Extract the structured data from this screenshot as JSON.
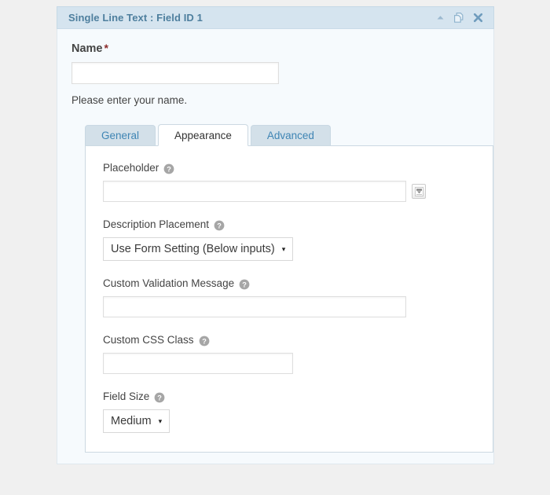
{
  "panel": {
    "title": "Single Line Text : Field ID 1",
    "header_icons": [
      {
        "name": "collapse-icon",
        "label": "Collapse"
      },
      {
        "name": "duplicate-icon",
        "label": "Duplicate"
      },
      {
        "name": "close-icon",
        "label": "Delete"
      }
    ],
    "field": {
      "label": "Name",
      "required_mark": "*",
      "input_value": "",
      "input_placeholder": "",
      "description": "Please enter your name."
    }
  },
  "tabs": [
    {
      "label": "General",
      "active": false
    },
    {
      "label": "Appearance",
      "active": true
    },
    {
      "label": "Advanced",
      "active": false
    }
  ],
  "settings": [
    {
      "label": "Placeholder",
      "help": "?",
      "control": "text",
      "value": "",
      "placeholder": "",
      "has_merge_tag": true
    },
    {
      "label": "Description Placement",
      "help": "?",
      "control": "select",
      "value": "Use Form Setting (Below inputs)",
      "caret": "▾"
    },
    {
      "label": "Custom Validation Message",
      "help": "?",
      "control": "text",
      "value": "",
      "placeholder": "",
      "has_merge_tag": false
    },
    {
      "label": "Custom CSS Class",
      "help": "?",
      "control": "text-narrow",
      "value": "",
      "placeholder": "",
      "has_merge_tag": false
    },
    {
      "label": "Field Size",
      "help": "?",
      "control": "select",
      "value": "Medium",
      "caret": "▾"
    }
  ],
  "colors": {
    "page_background": "#f0f0f0",
    "header_background": "#d5e4ef",
    "header_text": "#4e7f9e",
    "panel_background": "#f6fafd",
    "tab_inactive_background": "#d3e0e9",
    "tab_inactive_text": "#3f85b4",
    "tab_active_background": "#ffffff",
    "required_star": "#8b2b2b"
  }
}
